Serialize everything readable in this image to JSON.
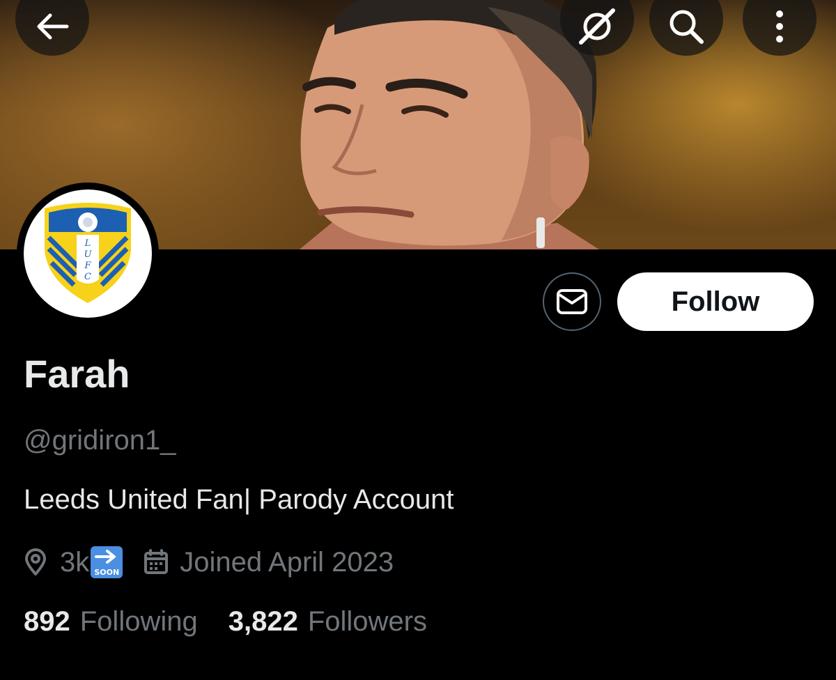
{
  "profile": {
    "display_name": "Farah",
    "handle": "@gridiron1_",
    "bio": "Leeds United Fan| Parody Account",
    "location": "3k",
    "location_emoji": "soon-arrow-emoji",
    "location_emoji_text": "SOON",
    "joined": "Joined April 2023",
    "following_count": "892",
    "following_label": "Following",
    "followers_count": "3,822",
    "followers_label": "Followers",
    "avatar_badge_letters": "LUFC"
  },
  "actions": {
    "follow_label": "Follow"
  },
  "icons": {
    "back": "back-arrow-icon",
    "grok": "grok-icon",
    "search": "search-icon",
    "more": "more-vertical-icon",
    "message": "envelope-icon",
    "location": "location-pin-icon",
    "calendar": "calendar-icon"
  },
  "colors": {
    "background": "#000000",
    "primary_text": "#e7e9ea",
    "secondary_text": "#71767b",
    "follow_button_bg": "#ffffff",
    "crest_yellow": "#f6d21b",
    "crest_blue": "#1d5fb0"
  }
}
